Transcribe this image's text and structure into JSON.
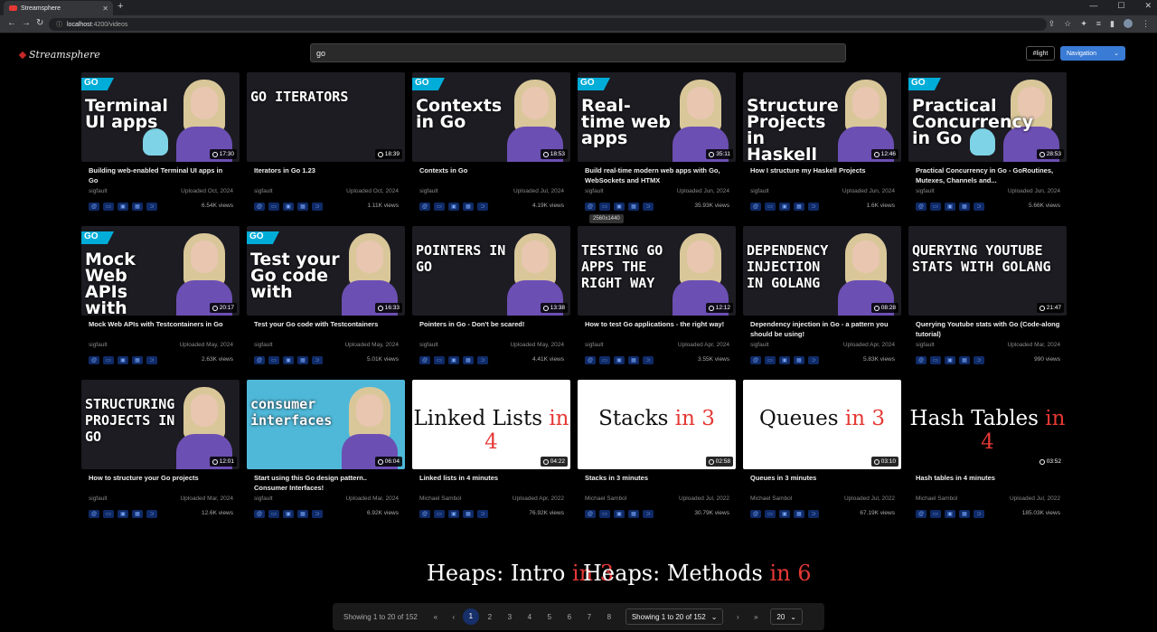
{
  "browser": {
    "tab_title": "Streamsphere",
    "url_host": "localhost",
    "url_path": ":4200/videos"
  },
  "header": {
    "logo": "Streamsphere",
    "search_value": "go",
    "theme_label": "#light",
    "nav_label": "Navigation"
  },
  "tooltip": "2560x1440",
  "videos": [
    {
      "thumb": "Terminal UI apps",
      "duration": "17:30",
      "title": "Building web-enabled Terminal UI apps in Go",
      "author": "sigfault",
      "uploaded": "Uploaded Oct, 2024",
      "views": "6.54K views"
    },
    {
      "thumb": "GO ITERATORS",
      "duration": "18:39",
      "title": "Iterators in Go 1.23",
      "author": "sigfault",
      "uploaded": "Uploaded Oct, 2024",
      "views": "1.11K views"
    },
    {
      "thumb": "Contexts in Go",
      "duration": "18:53",
      "title": "Contexts in Go",
      "author": "sigfault",
      "uploaded": "Uploaded Jul, 2024",
      "views": "4.19K views"
    },
    {
      "thumb": "Real-time web apps",
      "duration": "35:11",
      "title": "Build real-time modern web apps with Go, WebSockets and HTMX",
      "author": "sigfault",
      "uploaded": "Uploaded Jun, 2024",
      "views": "35.93K views"
    },
    {
      "thumb": "Structure Projects in Haskell",
      "duration": "12:46",
      "title": "How I structure my Haskell Projects",
      "author": "sigfault",
      "uploaded": "Uploaded Jun, 2024",
      "views": "1.6K views"
    },
    {
      "thumb": "Practical Concurrency in Go",
      "duration": "28:53",
      "title": "Practical Concurrency in Go - GoRoutines, Mutexes, Channels and...",
      "author": "sigfault",
      "uploaded": "Uploaded Jun, 2024",
      "views": "5.66K views"
    },
    {
      "thumb": "Mock Web APIs with",
      "duration": "20:17",
      "title": "Mock Web APIs with Testcontainers in Go",
      "author": "sigfault",
      "uploaded": "Uploaded May, 2024",
      "views": "2.63K views"
    },
    {
      "thumb": "Test your Go code with",
      "duration": "16:33",
      "title": "Test your Go code with Testcontainers",
      "author": "sigfault",
      "uploaded": "Uploaded May, 2024",
      "views": "5.01K views"
    },
    {
      "thumb": "POINTERS IN GO",
      "duration": "13:38",
      "title": "Pointers in Go - Don't be scared!",
      "author": "sigfault",
      "uploaded": "Uploaded May, 2024",
      "views": "4.41K views"
    },
    {
      "thumb": "TESTING GO APPS THE RIGHT WAY",
      "duration": "12:12",
      "title": "How to test Go applications - the right way!",
      "author": "sigfault",
      "uploaded": "Uploaded Apr, 2024",
      "views": "3.55K views"
    },
    {
      "thumb": "DEPENDENCY INJECTION IN GOLANG",
      "duration": "08:28",
      "title": "Dependency injection in Go - a pattern you should be using!",
      "author": "sigfault",
      "uploaded": "Uploaded Apr, 2024",
      "views": "5.83K views"
    },
    {
      "thumb": "QUERYING YOUTUBE STATS WITH GOLANG",
      "duration": "21:47",
      "title": "Querying Youtube stats with Go (Code-along tutorial)",
      "author": "sigfault",
      "uploaded": "Uploaded Mar, 2024",
      "views": "990 views"
    },
    {
      "thumb": "STRUCTURING PROJECTS IN GO",
      "duration": "12:01",
      "title": "How to structure your Go projects",
      "author": "sigfault",
      "uploaded": "Uploaded Mar, 2024",
      "views": "12.6K views"
    },
    {
      "thumb": "consumer interfaces",
      "duration": "06:04",
      "title": "Start using this Go design pattern.. Consumer Interfaces!",
      "author": "sigfault",
      "uploaded": "Uploaded Mar, 2024",
      "views": "6.92K views"
    },
    {
      "thumb": "Linked Lists",
      "thumb_accent": "in 4",
      "duration": "04:22",
      "title": "Linked lists in 4 minutes",
      "author": "Michael Sambol",
      "uploaded": "Uploaded Apr, 2022",
      "views": "76.92K views"
    },
    {
      "thumb": "Stacks",
      "thumb_accent": "in 3",
      "duration": "02:58",
      "title": "Stacks in 3 minutes",
      "author": "Michael Sambol",
      "uploaded": "Uploaded Jul, 2022",
      "views": "30.79K views"
    },
    {
      "thumb": "Queues",
      "thumb_accent": "in 3",
      "duration": "03:10",
      "title": "Queues in 3 minutes",
      "author": "Michael Sambol",
      "uploaded": "Uploaded Jul, 2022",
      "views": "67.19K views"
    },
    {
      "thumb": "Hash Tables",
      "thumb_accent": "in 4",
      "duration": "03:52",
      "title": "Hash tables in 4 minutes",
      "author": "Michael Sambol",
      "uploaded": "Uploaded Jul, 2022",
      "views": "185.03K views"
    }
  ],
  "partial_row": [
    {
      "text": "Heaps: Intro",
      "accent": "in 3"
    },
    {
      "text": "Heaps: Methods",
      "accent": "in 6"
    }
  ],
  "pagination": {
    "showing": "Showing 1 to 20 of 152",
    "pages": [
      "1",
      "2",
      "3",
      "4",
      "5",
      "6",
      "7",
      "8"
    ],
    "active_page": "1",
    "select_label": "Showing 1 to 20 of 152",
    "page_size": "20"
  },
  "colors": {
    "accent": "#e53935",
    "primary": "#3a7bd5",
    "go_blue": "#00add8"
  }
}
